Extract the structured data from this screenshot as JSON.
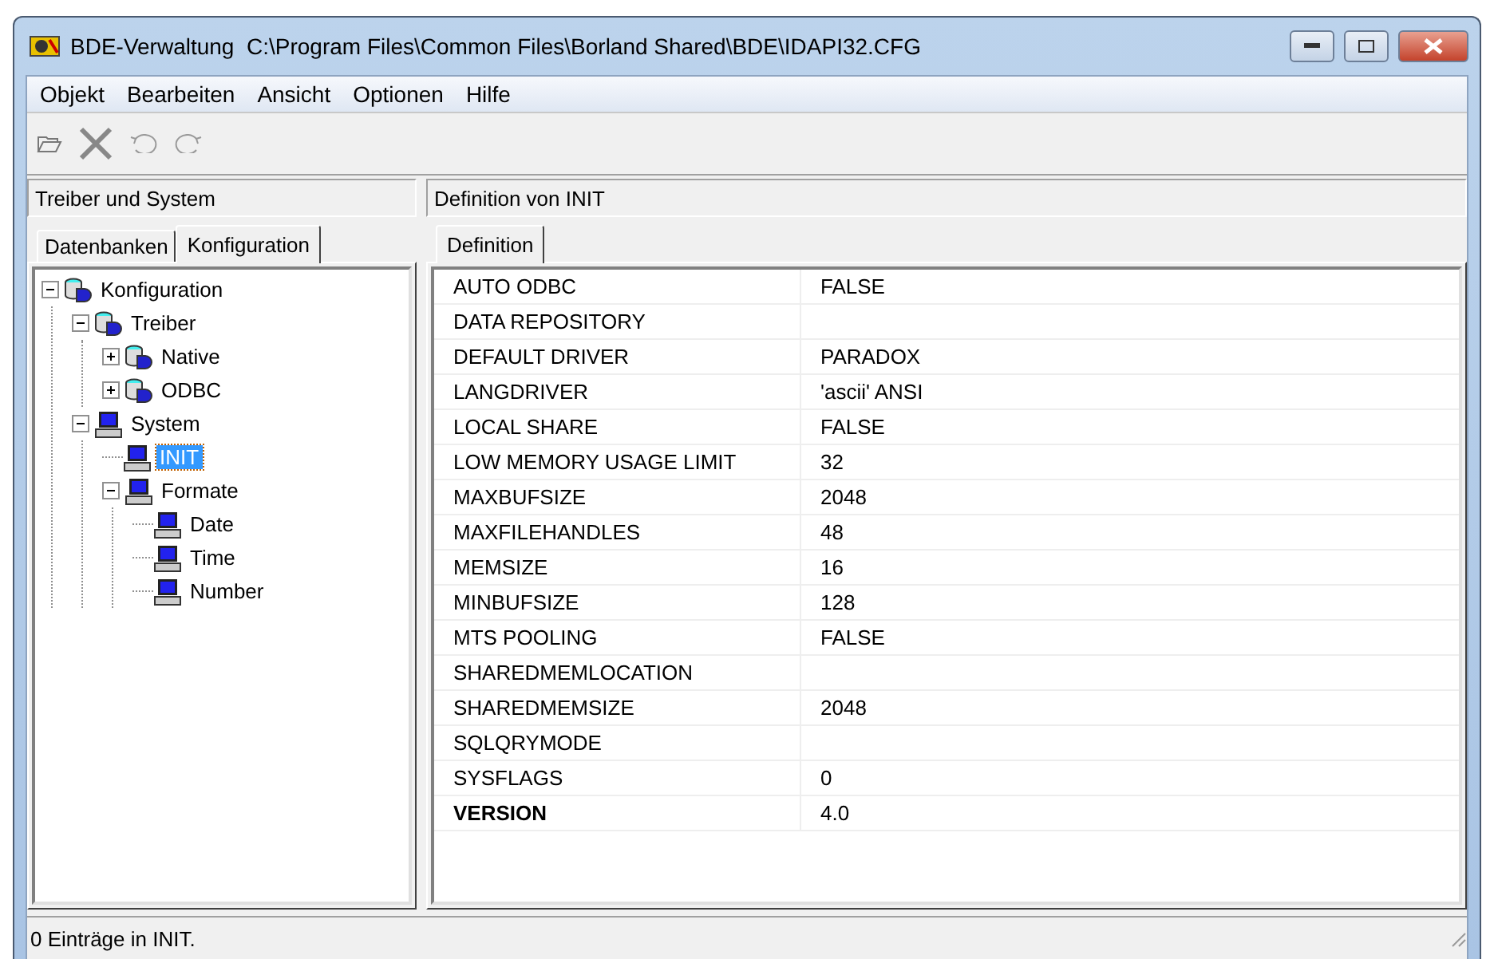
{
  "window": {
    "title": "BDE-Verwaltung  C:\\Program Files\\Common Files\\Borland Shared\\BDE\\IDAPI32.CFG"
  },
  "menu": [
    "Objekt",
    "Bearbeiten",
    "Ansicht",
    "Optionen",
    "Hilfe"
  ],
  "left_panel": {
    "header": "Treiber und System",
    "tabs": [
      {
        "label": "Datenbanken",
        "selected": false
      },
      {
        "label": "Konfiguration",
        "selected": true
      }
    ],
    "tree": [
      {
        "label": "Konfiguration",
        "kind": "database",
        "expanded": true,
        "selected": false,
        "children": [
          {
            "label": "Treiber",
            "kind": "database",
            "expanded": true,
            "selected": false,
            "children": [
              {
                "label": "Native",
                "kind": "database",
                "expanded": false,
                "selected": false
              },
              {
                "label": "ODBC",
                "kind": "database",
                "expanded": false,
                "selected": false
              }
            ]
          },
          {
            "label": "System",
            "kind": "computer",
            "expanded": true,
            "selected": false,
            "children": [
              {
                "label": "INIT",
                "kind": "computer",
                "selected": true
              },
              {
                "label": "Formate",
                "kind": "computer",
                "expanded": true,
                "selected": false,
                "children": [
                  {
                    "label": "Date",
                    "kind": "computer",
                    "selected": false
                  },
                  {
                    "label": "Time",
                    "kind": "computer",
                    "selected": false
                  },
                  {
                    "label": "Number",
                    "kind": "computer",
                    "selected": false
                  }
                ]
              }
            ]
          }
        ]
      }
    ]
  },
  "right_panel": {
    "header": "Definition von INIT",
    "tabs": [
      {
        "label": "Definition",
        "selected": true
      }
    ],
    "properties": [
      {
        "name": "AUTO ODBC",
        "value": "FALSE",
        "bold": false
      },
      {
        "name": "DATA REPOSITORY",
        "bold": false
      },
      {
        "name": "DEFAULT DRIVER",
        "value": "PARADOX",
        "bold": false
      },
      {
        "name": "LANGDRIVER",
        "value": "'ascii' ANSI",
        "bold": false
      },
      {
        "name": "LOCAL SHARE",
        "value": "FALSE",
        "bold": false
      },
      {
        "name": "LOW MEMORY USAGE LIMIT",
        "value": "32",
        "bold": false
      },
      {
        "name": "MAXBUFSIZE",
        "value": "2048",
        "bold": false
      },
      {
        "name": "MAXFILEHANDLES",
        "value": "48",
        "bold": false
      },
      {
        "name": "MEMSIZE",
        "value": "16",
        "bold": false
      },
      {
        "name": "MINBUFSIZE",
        "value": "128",
        "bold": false
      },
      {
        "name": "MTS POOLING",
        "value": "FALSE",
        "bold": false
      },
      {
        "name": "SHAREDMEMLOCATION",
        "bold": false
      },
      {
        "name": "SHAREDMEMSIZE",
        "value": "2048",
        "bold": false
      },
      {
        "name": "SQLQRYMODE",
        "bold": false
      },
      {
        "name": "SYSFLAGS",
        "value": "0",
        "bold": false
      },
      {
        "name": "VERSION",
        "value": "4.0",
        "bold": true
      }
    ]
  },
  "status_bar": "0 Einträge in INIT."
}
